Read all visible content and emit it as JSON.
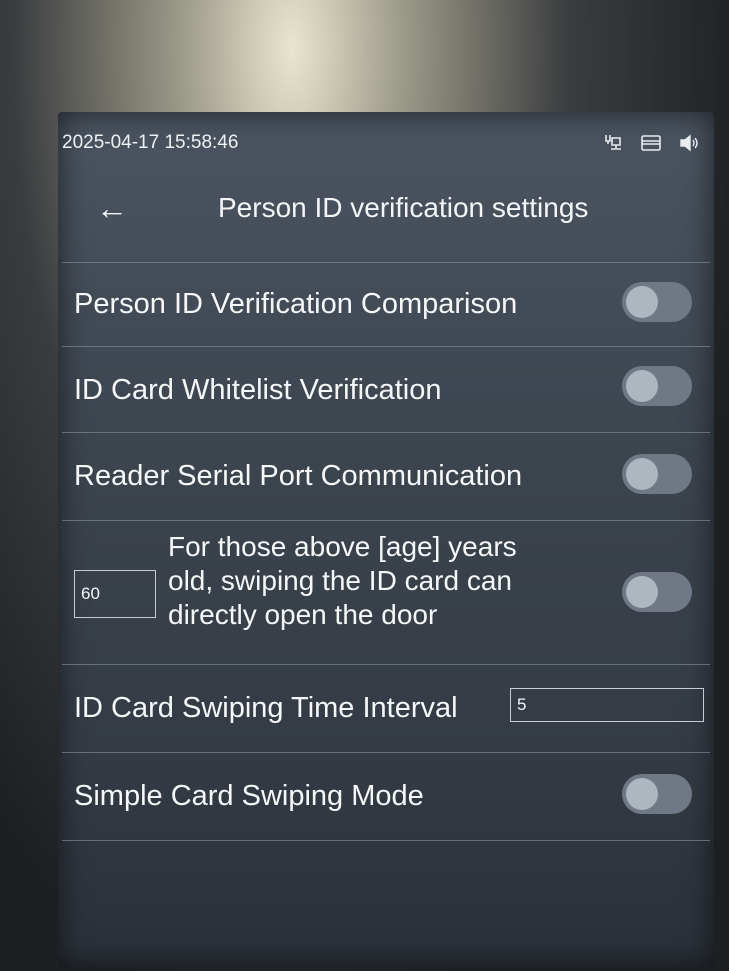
{
  "status_bar": {
    "datetime": "2025-04-17 15:58:46",
    "icons": [
      "network-icon",
      "card-icon",
      "volume-icon"
    ]
  },
  "header": {
    "back_label": "←",
    "title": "Person ID verification settings"
  },
  "settings": {
    "person_id_comparison": {
      "label": "Person ID Verification Comparison",
      "enabled": false
    },
    "id_whitelist": {
      "label": "ID Card Whitelist Verification",
      "enabled": false
    },
    "reader_serial": {
      "label": "Reader Serial Port Communication",
      "enabled": false
    },
    "age_open_door": {
      "age_value": "60",
      "line1": "For those above [age] years",
      "line2": "old, swiping the ID card can",
      "line3": "directly open the door",
      "enabled": false
    },
    "swipe_interval": {
      "label": "ID Card Swiping Time Interval",
      "value": "5"
    },
    "simple_swipe": {
      "label": "Simple Card Swiping Mode",
      "enabled": false
    }
  },
  "colors": {
    "screen_bg": "#3c444e",
    "text": "#f6f7f9",
    "toggle_off": "#6f7884"
  }
}
